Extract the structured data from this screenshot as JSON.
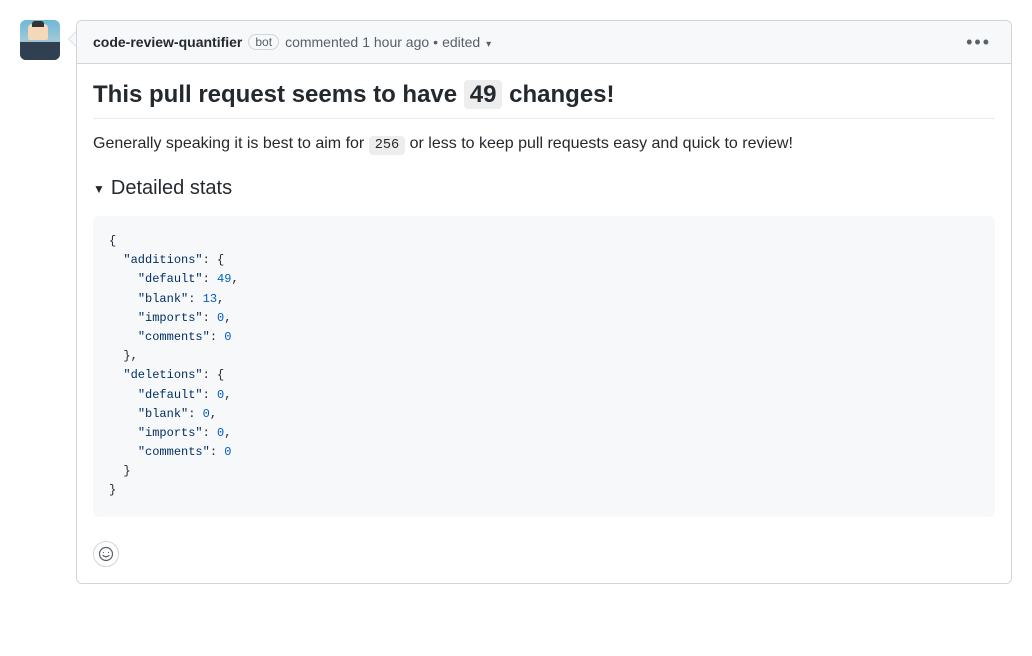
{
  "comment": {
    "author": "code-review-quantifier",
    "bot_label": "bot",
    "action_text": "commented",
    "timestamp": "1 hour ago",
    "edited_text": "edited",
    "separator": "•"
  },
  "body": {
    "title_prefix": "This pull request seems to have ",
    "title_count": "49",
    "title_suffix": " changes!",
    "guidance_prefix": "Generally speaking it is best to aim for ",
    "guidance_limit": "256",
    "guidance_suffix": " or less to keep pull requests easy and quick to review!",
    "details_heading": "Detailed stats"
  },
  "stats": {
    "additions": {
      "default": 49,
      "blank": 13,
      "imports": 0,
      "comments": 0
    },
    "deletions": {
      "default": 0,
      "blank": 0,
      "imports": 0,
      "comments": 0
    }
  }
}
